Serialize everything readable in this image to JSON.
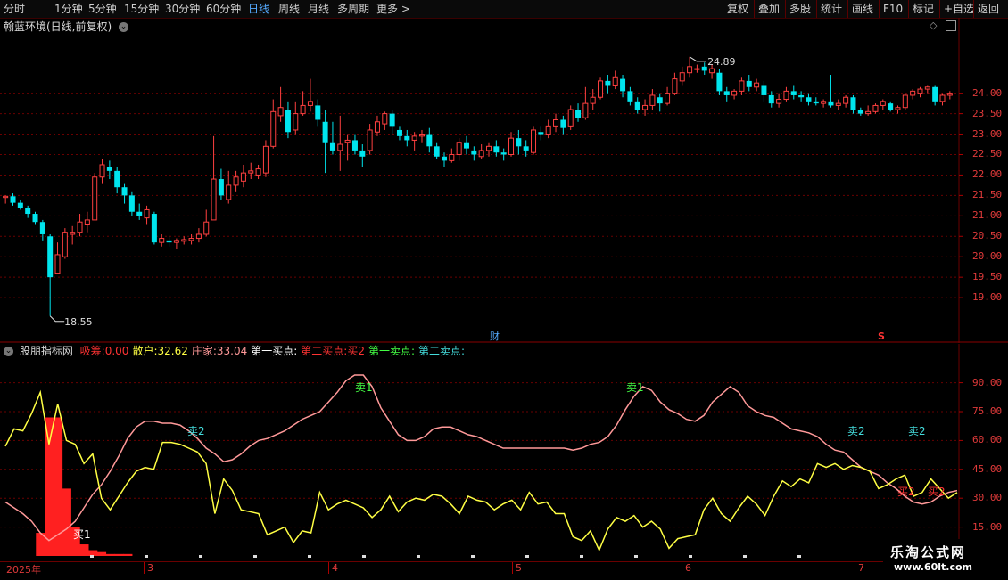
{
  "toolbar": {
    "periods": [
      "分时",
      "1分钟",
      "5分钟",
      "15分钟",
      "30分钟",
      "60分钟",
      "日线",
      "周线",
      "月线",
      "多周期",
      "更多 >"
    ],
    "active_period": "日线",
    "right_buttons": [
      "复权",
      "叠加",
      "多股",
      "统计",
      "画线",
      "F10",
      "标记",
      "+自选",
      "返回"
    ]
  },
  "main_panel": {
    "title": "翰蓝环境(日线,前复权)",
    "high_label": "24.89",
    "low_label": "18.55",
    "marker_cai": "财",
    "marker_s": "S",
    "y_ticks": [
      "24.00",
      "23.50",
      "23.00",
      "22.50",
      "22.00",
      "21.50",
      "21.00",
      "20.50",
      "20.00",
      "19.50",
      "19.00"
    ]
  },
  "indicator_panel": {
    "name": "股朋指标网",
    "items": [
      {
        "label": "吸筹:",
        "value": "0.00",
        "color": "#ff3333"
      },
      {
        "label": "散户:",
        "value": "32.62",
        "color": "#ffff44"
      },
      {
        "label": "庄家:",
        "value": "33.04",
        "color": "#ff9999"
      },
      {
        "label": "第一买点:",
        "value": "",
        "color": "#ffffff"
      },
      {
        "label": "第二买点:",
        "value": "买2",
        "color": "#ff3333"
      },
      {
        "label": "第一卖点:",
        "value": "",
        "color": "#44ff44"
      },
      {
        "label": "第二卖点:",
        "value": "",
        "color": "#44dddd"
      }
    ],
    "y_ticks": [
      "90.00",
      "75.00",
      "60.00",
      "45.00",
      "30.00",
      "15.00"
    ],
    "signals": [
      {
        "text": "卖1",
        "color": "#44ff44"
      },
      {
        "text": "卖2",
        "color": "#44dddd"
      },
      {
        "text": "卖1",
        "color": "#44ff44"
      },
      {
        "text": "卖2",
        "color": "#44dddd"
      },
      {
        "text": "卖2",
        "color": "#44dddd"
      },
      {
        "text": "买1",
        "color": "#ffffff"
      },
      {
        "text": "买2",
        "color": "#ff3333"
      },
      {
        "text": "买2",
        "color": "#ff3333"
      }
    ]
  },
  "x_axis": [
    "2025年",
    "3",
    "4",
    "5",
    "6",
    "7"
  ],
  "watermark": {
    "name": "乐淘公式网",
    "url": "www.60lt.com"
  },
  "colors": {
    "up": "#ff4040",
    "down": "#00e5ee",
    "grid": "#6a0000"
  },
  "chart_data": [
    {
      "type": "candlestick",
      "title": "翰蓝环境(日线,前复权)",
      "ylim": [
        18.4,
        25.2
      ],
      "high_marker": 24.89,
      "low_marker": 18.55,
      "candles": [
        [
          21.45,
          21.48,
          21.5,
          21.3
        ],
        [
          21.48,
          21.32,
          21.55,
          21.25
        ],
        [
          21.32,
          21.2,
          21.4,
          21.15
        ],
        [
          21.2,
          21.05,
          21.25,
          20.95
        ],
        [
          21.05,
          20.85,
          21.1,
          20.8
        ],
        [
          20.85,
          20.55,
          20.9,
          20.4
        ],
        [
          20.5,
          19.5,
          20.55,
          18.55
        ],
        [
          19.6,
          20.05,
          20.35,
          19.6
        ],
        [
          20.0,
          20.6,
          20.7,
          19.95
        ],
        [
          20.55,
          20.6,
          20.75,
          20.3
        ],
        [
          20.6,
          20.85,
          21.05,
          20.5
        ],
        [
          20.8,
          20.9,
          21.1,
          20.6
        ],
        [
          20.9,
          21.95,
          22.05,
          20.9
        ],
        [
          21.95,
          22.25,
          22.4,
          21.8
        ],
        [
          22.2,
          22.1,
          22.35,
          21.9
        ],
        [
          22.1,
          21.7,
          22.2,
          21.55
        ],
        [
          21.7,
          21.5,
          21.8,
          21.3
        ],
        [
          21.5,
          21.1,
          21.6,
          21.0
        ],
        [
          21.1,
          21.0,
          21.3,
          20.9
        ],
        [
          20.95,
          21.15,
          21.25,
          20.8
        ],
        [
          21.05,
          20.35,
          21.1,
          20.3
        ],
        [
          20.35,
          20.45,
          20.55,
          20.25
        ],
        [
          20.4,
          20.35,
          20.5,
          20.25
        ],
        [
          20.35,
          20.4,
          20.45,
          20.2
        ],
        [
          20.38,
          20.42,
          20.5,
          20.3
        ],
        [
          20.4,
          20.45,
          20.55,
          20.3
        ],
        [
          20.45,
          20.55,
          20.7,
          20.35
        ],
        [
          20.55,
          20.85,
          21.15,
          20.5
        ],
        [
          20.9,
          21.9,
          22.95,
          20.9
        ],
        [
          21.9,
          21.5,
          22.15,
          21.4
        ],
        [
          21.4,
          21.75,
          22.1,
          21.3
        ],
        [
          21.75,
          21.95,
          22.1,
          21.6
        ],
        [
          21.85,
          22.05,
          22.25,
          21.7
        ],
        [
          22.05,
          22.1,
          22.3,
          21.9
        ],
        [
          22.0,
          22.15,
          22.25,
          21.9
        ],
        [
          22.05,
          22.7,
          22.85,
          21.95
        ],
        [
          22.7,
          23.55,
          23.85,
          22.65
        ],
        [
          23.45,
          23.65,
          24.15,
          23.3
        ],
        [
          23.6,
          23.05,
          23.8,
          22.9
        ],
        [
          23.1,
          23.5,
          23.8,
          23.0
        ],
        [
          23.5,
          23.7,
          24.05,
          23.45
        ],
        [
          23.7,
          23.8,
          24.35,
          23.55
        ],
        [
          23.7,
          23.35,
          23.85,
          23.2
        ],
        [
          23.3,
          22.8,
          23.6,
          22.05
        ],
        [
          22.8,
          22.6,
          23.3,
          22.5
        ],
        [
          22.6,
          22.75,
          23.45,
          22.1
        ],
        [
          22.8,
          22.85,
          23.0,
          22.35
        ],
        [
          22.85,
          22.6,
          23.0,
          22.5
        ],
        [
          22.6,
          22.45,
          22.75,
          22.2
        ],
        [
          22.6,
          23.1,
          23.25,
          22.5
        ],
        [
          23.05,
          23.3,
          23.45,
          22.95
        ],
        [
          23.25,
          23.5,
          23.55,
          23.1
        ],
        [
          23.5,
          23.2,
          23.6,
          23.0
        ],
        [
          23.1,
          22.95,
          23.2,
          22.85
        ],
        [
          22.95,
          22.85,
          23.1,
          22.7
        ],
        [
          22.85,
          22.95,
          23.05,
          22.6
        ],
        [
          22.95,
          23.0,
          23.1,
          22.8
        ],
        [
          23.0,
          22.7,
          23.15,
          22.55
        ],
        [
          22.7,
          22.45,
          22.8,
          22.4
        ],
        [
          22.45,
          22.35,
          22.55,
          22.2
        ],
        [
          22.35,
          22.5,
          22.65,
          22.3
        ],
        [
          22.5,
          22.8,
          22.9,
          22.35
        ],
        [
          22.8,
          22.65,
          22.95,
          22.5
        ],
        [
          22.6,
          22.5,
          22.7,
          22.35
        ],
        [
          22.45,
          22.6,
          22.75,
          22.4
        ],
        [
          22.6,
          22.7,
          22.8,
          22.45
        ],
        [
          22.7,
          22.55,
          22.85,
          22.45
        ],
        [
          22.55,
          22.5,
          22.65,
          22.35
        ],
        [
          22.5,
          22.9,
          23.05,
          22.45
        ],
        [
          22.9,
          22.7,
          23.1,
          22.5
        ],
        [
          22.7,
          22.6,
          22.85,
          22.45
        ],
        [
          22.55,
          23.1,
          23.2,
          22.5
        ],
        [
          23.05,
          23.0,
          23.2,
          22.85
        ],
        [
          23.0,
          23.2,
          23.35,
          22.9
        ],
        [
          23.2,
          23.35,
          23.5,
          23.05
        ],
        [
          23.35,
          23.15,
          23.45,
          23.0
        ],
        [
          23.2,
          23.6,
          23.7,
          23.1
        ],
        [
          23.6,
          23.4,
          23.75,
          23.3
        ],
        [
          23.4,
          23.75,
          24.15,
          23.35
        ],
        [
          23.75,
          23.9,
          24.1,
          23.6
        ],
        [
          23.9,
          24.3,
          24.4,
          23.85
        ],
        [
          24.3,
          24.2,
          24.45,
          24.0
        ],
        [
          24.2,
          24.4,
          24.55,
          24.1
        ],
        [
          24.35,
          24.05,
          24.45,
          23.9
        ],
        [
          24.05,
          23.8,
          24.15,
          23.7
        ],
        [
          23.8,
          23.6,
          23.9,
          23.5
        ],
        [
          23.6,
          23.7,
          23.85,
          23.45
        ],
        [
          23.7,
          23.95,
          24.1,
          23.6
        ],
        [
          23.9,
          23.75,
          24.0,
          23.55
        ],
        [
          23.75,
          24.0,
          24.15,
          23.7
        ],
        [
          24.0,
          24.35,
          24.5,
          23.95
        ],
        [
          24.3,
          24.5,
          24.65,
          24.2
        ],
        [
          24.5,
          24.65,
          24.89,
          24.4
        ],
        [
          24.6,
          24.6,
          24.7,
          24.5
        ],
        [
          24.65,
          24.55,
          24.75,
          24.45
        ],
        [
          24.5,
          24.6,
          24.7,
          24.35
        ],
        [
          24.5,
          24.05,
          24.6,
          23.95
        ],
        [
          24.05,
          23.95,
          24.15,
          23.8
        ],
        [
          23.95,
          24.05,
          24.1,
          23.85
        ],
        [
          24.05,
          24.3,
          24.4,
          23.95
        ],
        [
          24.3,
          24.15,
          24.45,
          24.05
        ],
        [
          24.15,
          24.25,
          24.35,
          24.05
        ],
        [
          24.2,
          23.95,
          24.3,
          23.8
        ],
        [
          23.95,
          23.75,
          24.05,
          23.65
        ],
        [
          23.75,
          23.85,
          24.0,
          23.65
        ],
        [
          23.85,
          24.05,
          24.15,
          23.8
        ],
        [
          24.05,
          23.95,
          24.2,
          23.85
        ],
        [
          23.95,
          23.9,
          24.05,
          23.8
        ],
        [
          23.9,
          23.8,
          24.0,
          23.7
        ],
        [
          23.8,
          23.75,
          23.9,
          23.7
        ],
        [
          23.75,
          23.8,
          23.85,
          23.65
        ],
        [
          23.8,
          23.7,
          24.45,
          23.65
        ],
        [
          23.7,
          23.75,
          23.85,
          23.6
        ],
        [
          23.75,
          23.9,
          23.95,
          23.65
        ],
        [
          23.9,
          23.6,
          23.95,
          23.5
        ],
        [
          23.6,
          23.5,
          23.65,
          23.45
        ],
        [
          23.5,
          23.55,
          23.7,
          23.45
        ],
        [
          23.55,
          23.7,
          23.75,
          23.5
        ],
        [
          23.7,
          23.8,
          23.85,
          23.6
        ],
        [
          23.75,
          23.6,
          23.8,
          23.55
        ],
        [
          23.6,
          23.65,
          23.7,
          23.5
        ],
        [
          23.65,
          23.95,
          24.0,
          23.6
        ],
        [
          23.95,
          24.05,
          24.1,
          23.85
        ],
        [
          24.0,
          24.1,
          24.15,
          23.9
        ],
        [
          24.1,
          24.15,
          24.2,
          24.0
        ],
        [
          24.15,
          23.8,
          24.2,
          23.7
        ],
        [
          23.8,
          23.95,
          24.0,
          23.7
        ],
        [
          23.95,
          24.0,
          24.05,
          23.85
        ]
      ]
    },
    {
      "type": "line",
      "title": "股朋指标网",
      "ylim": [
        0,
        100
      ],
      "series": [
        {
          "name": "散户",
          "color": "#ffff44",
          "values": [
            57,
            66,
            65,
            74,
            85,
            58,
            79,
            60,
            58,
            48,
            53,
            30,
            24,
            31,
            38,
            44,
            46,
            45,
            59,
            59,
            58,
            56,
            54,
            48,
            22,
            40,
            34,
            24,
            23,
            22,
            11,
            13,
            15,
            7,
            13,
            12,
            33,
            24,
            27,
            29,
            27,
            25,
            20,
            24,
            31,
            23,
            28,
            30,
            29,
            32,
            31,
            27,
            22,
            31,
            29,
            28,
            24,
            27,
            29,
            24,
            33,
            27,
            28,
            22,
            22,
            10,
            8,
            13,
            3,
            14,
            20,
            18,
            21,
            15,
            18,
            14,
            4,
            9,
            10,
            11,
            24,
            30,
            22,
            18,
            25,
            31,
            27,
            21,
            31,
            39,
            36,
            40,
            38,
            48,
            46,
            48,
            45,
            47,
            46,
            44,
            35,
            37,
            40,
            42,
            31,
            33,
            40,
            35,
            30,
            33
          ]
        },
        {
          "name": "庄家",
          "color": "#ff9999",
          "values": [
            28,
            25,
            22,
            18,
            12,
            8,
            11,
            14,
            18,
            25,
            32,
            37,
            44,
            52,
            61,
            67,
            70,
            70,
            69,
            69,
            68,
            65,
            61,
            56,
            53,
            49,
            50,
            53,
            57,
            60,
            61,
            63,
            65,
            68,
            71,
            73,
            75,
            80,
            85,
            91,
            94,
            94,
            88,
            77,
            70,
            63,
            60,
            60,
            62,
            66,
            67,
            67,
            65,
            63,
            62,
            60,
            58,
            56,
            56,
            56,
            56,
            56,
            56,
            56,
            56,
            55,
            56,
            58,
            59,
            62,
            68,
            76,
            83,
            88,
            86,
            80,
            76,
            74,
            71,
            70,
            73,
            80,
            84,
            88,
            85,
            78,
            75,
            73,
            72,
            69,
            66,
            65,
            64,
            62,
            58,
            55,
            54,
            50,
            46,
            44,
            42,
            38,
            35,
            31,
            28,
            27,
            28,
            31,
            33,
            34
          ]
        },
        {
          "name": "吸筹",
          "color": "#ff2020",
          "type": "bar",
          "values": [
            0,
            0,
            0,
            0,
            12,
            72,
            72,
            35,
            15,
            6,
            3,
            2,
            1,
            1,
            1,
            0,
            0,
            0,
            0,
            0,
            0,
            0,
            0,
            0,
            0,
            0,
            0,
            0,
            0,
            0,
            0,
            0,
            0,
            0,
            0,
            0,
            0,
            0,
            0,
            0,
            0,
            0,
            0,
            0,
            0,
            0,
            0,
            0,
            0,
            0,
            0,
            0,
            0,
            0,
            0,
            0,
            0,
            0,
            0,
            0,
            0,
            0,
            0,
            0,
            0,
            0,
            0,
            0,
            0,
            0,
            0,
            0,
            0,
            0,
            0,
            0,
            0,
            0,
            0,
            0,
            0,
            0,
            0,
            0,
            0,
            0,
            0,
            0,
            0,
            0,
            0,
            0,
            0,
            0,
            0,
            0,
            0,
            0,
            0,
            0,
            0,
            0,
            0,
            0,
            0,
            0,
            0,
            0,
            0,
            0
          ]
        }
      ]
    }
  ]
}
